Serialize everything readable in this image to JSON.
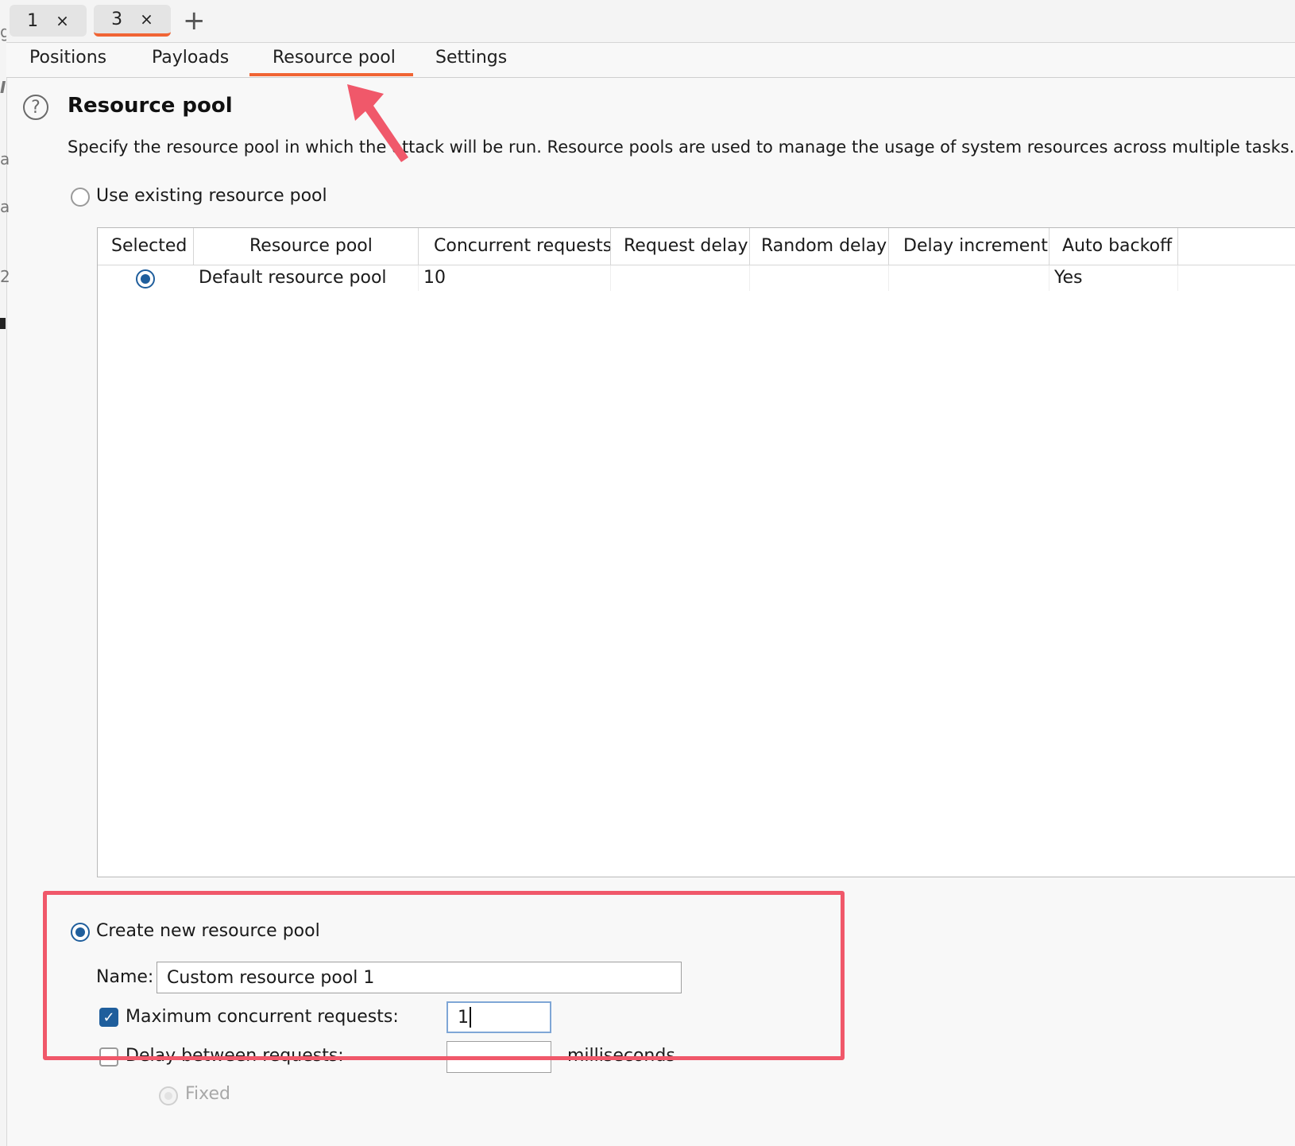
{
  "request_tabs": [
    {
      "label": "1",
      "close": "×"
    },
    {
      "label": "3",
      "close": "×"
    }
  ],
  "new_tab_glyph": "+",
  "sub_tabs": [
    "Positions",
    "Payloads",
    "Resource pool",
    "Settings"
  ],
  "active_sub_tab": "Resource pool",
  "section": {
    "help_glyph": "?",
    "title": "Resource pool",
    "description": "Specify the resource pool in which the attack will be run. Resource pools are used to manage the usage of system resources across multiple tasks."
  },
  "use_existing_label": "Use existing resource pool",
  "pool_table": {
    "columns": [
      "Selected",
      "Resource pool",
      "Concurrent requests",
      "Request delay",
      "Random delay",
      "Delay increment",
      "Auto backoff"
    ],
    "rows": [
      {
        "selected": true,
        "resource_pool": "Default resource pool",
        "concurrent_requests": "10",
        "request_delay": "",
        "random_delay": "",
        "delay_increment": "",
        "auto_backoff": "Yes"
      }
    ]
  },
  "create_new": {
    "radio_label": "Create new resource pool",
    "name_label": "Name:",
    "name_value": "Custom resource pool 1",
    "max_concurrent_label": "Maximum concurrent requests:",
    "max_concurrent_checked": true,
    "max_concurrent_value": "1",
    "delay_label": "Delay between requests:",
    "delay_checked": false,
    "delay_value": "",
    "delay_unit": "milliseconds",
    "fixed_label": "Fixed"
  },
  "colors": {
    "accent_tab": "#f06434",
    "highlight_box": "#f0586a",
    "annotation_arrow": "#f0586a",
    "control_blue": "#1f5e9c"
  },
  "gutter_glyphs": [
    "g",
    "I",
    "a",
    "a",
    "2"
  ]
}
